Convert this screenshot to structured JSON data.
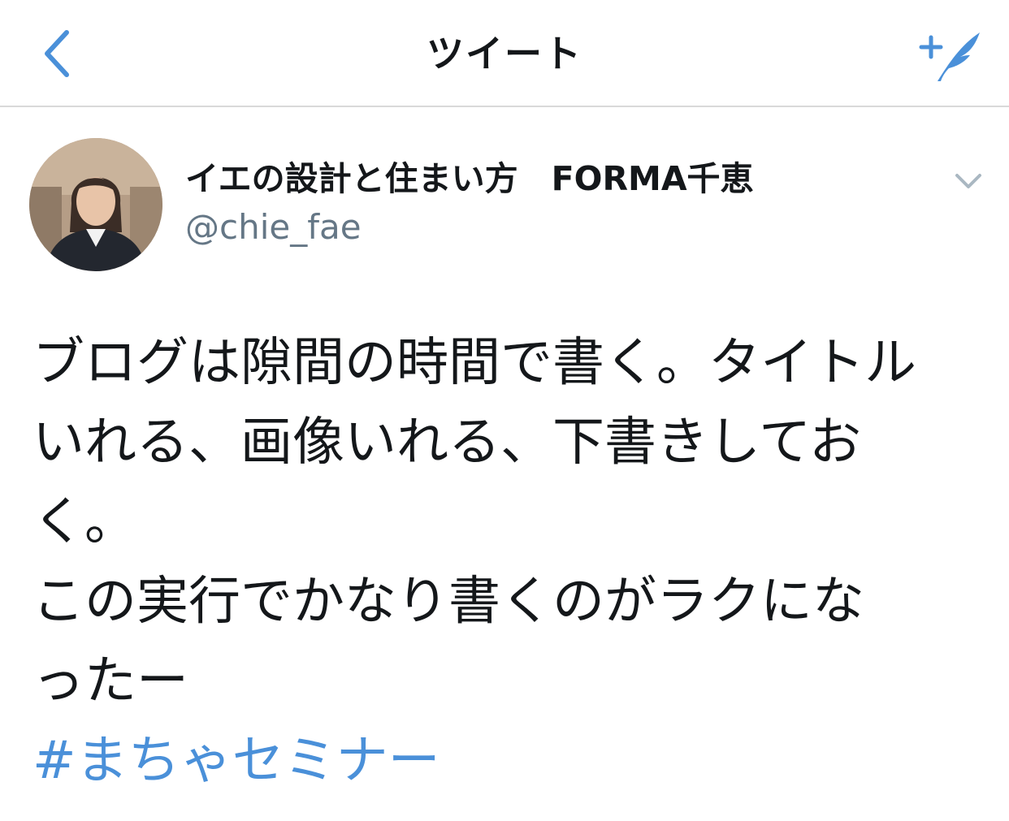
{
  "nav": {
    "title": "ツイート",
    "back_icon": "chevron-left-icon",
    "compose_icon": "compose-quill-icon"
  },
  "tweet": {
    "display_name": "イエの設計と住まい方　FORMA千恵",
    "handle": "@chie_fae",
    "lines": [
      "ブログは隙間の時間で書く。タイトル",
      "いれる、画像いれる、下書きしてお",
      "く。",
      "この実行でかなり書くのがラクにな",
      "ったー"
    ],
    "hashtag": "#まちゃセミナー"
  },
  "colors": {
    "accent": "#4a90d9",
    "text": "#14171a",
    "secondary": "#657786",
    "divider": "#d9d9d9"
  }
}
